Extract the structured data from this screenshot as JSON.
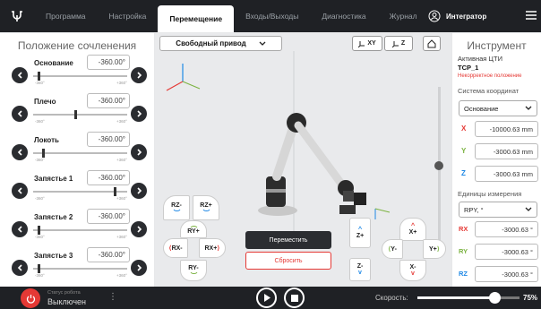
{
  "nav": {
    "tabs": [
      {
        "label": "Программа"
      },
      {
        "label": "Настройка"
      },
      {
        "label": "Перемещение"
      },
      {
        "label": "Входы/Выходы"
      },
      {
        "label": "Диагностика"
      },
      {
        "label": "Журнал"
      }
    ],
    "user": "Интегратор"
  },
  "left": {
    "title": "Положение сочленения",
    "min_label": "-360°",
    "max_label": "+360°",
    "joints": [
      {
        "name": "Основание",
        "value": "-360.00°",
        "level": 0.05
      },
      {
        "name": "Плечо",
        "value": "-360.00°",
        "level": 0.45
      },
      {
        "name": "Локоть",
        "value": "-360.00°",
        "level": 0.1
      },
      {
        "name": "Запястье 1",
        "value": "-360.00°",
        "level": 0.88
      },
      {
        "name": "Запястье 2",
        "value": "-360.00°",
        "level": 0.05
      },
      {
        "name": "Запястье 3",
        "value": "-360.00°",
        "level": 0.05
      }
    ]
  },
  "view": {
    "mode": "Свободный привод",
    "btn_xy": "XY",
    "btn_z": "Z",
    "jog": {
      "rz_minus": "RZ-",
      "rz_plus": "RZ+",
      "ry_plus": "RY+",
      "ry_minus": "RY-",
      "rx_minus": "RX-",
      "rx_plus": "RX+",
      "z_plus": "Z+",
      "z_minus": "Z-",
      "x_plus": "X+",
      "x_minus": "X-",
      "y_minus": "Y-",
      "y_plus": "Y+"
    },
    "move_label": "Переместить",
    "reset_label": "Сбросить"
  },
  "right": {
    "title": "Инструмент",
    "active_label": "Активная ЦТИ",
    "tcp": "TCP_1",
    "warning": "Некорректное положение",
    "coord_label": "Система координат",
    "coord_value": "Основание",
    "pos": [
      {
        "axis": "X",
        "value": "-10000.63 mm",
        "color": "#e53935"
      },
      {
        "axis": "Y",
        "value": "-3000.63 mm",
        "color": "#7cb342"
      },
      {
        "axis": "Z",
        "value": "-3000.63 mm",
        "color": "#1e88e5"
      }
    ],
    "units_label": "Единицы измерения",
    "units_value": "RPY, °",
    "rot": [
      {
        "axis": "RX",
        "value": "-3000.63 °",
        "color": "#e53935"
      },
      {
        "axis": "RY",
        "value": "-3000.63 °",
        "color": "#7cb342"
      },
      {
        "axis": "RZ",
        "value": "-3000.63 °",
        "color": "#1e88e5"
      }
    ]
  },
  "status": {
    "label": "Статус робота",
    "state": "Выключен",
    "speed_label": "Скорость:",
    "speed_value": "75%",
    "speed_level": 0.75
  }
}
